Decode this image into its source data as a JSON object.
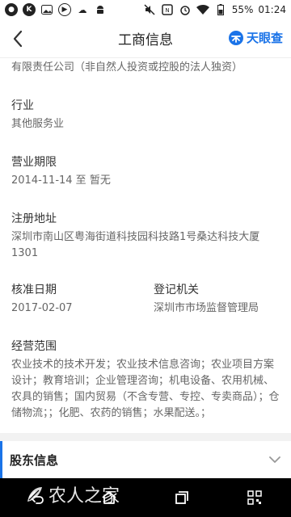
{
  "status_bar": {
    "battery": "55%",
    "time": "01:24",
    "icons": [
      "notification-circle-icon",
      "k-app-icon",
      "image-icon",
      "play-icon",
      "cloud-icon",
      "android-icon",
      "mute-icon",
      "nfc-icon",
      "alarm-icon",
      "wifi-icon",
      "battery-icon"
    ]
  },
  "header": {
    "title": "工商信息",
    "brand": "天眼查"
  },
  "content": {
    "company_type_tail": "有限责任公司（非自然人投资或控股的法人独资）",
    "industry": {
      "label": "行业",
      "value": "其他服务业"
    },
    "business_period": {
      "label": "营业期限",
      "value": "2014-11-14 至 暂无"
    },
    "registered_address": {
      "label": "注册地址",
      "value": "深圳市南山区粤海街道科技园科技路1号桑达科技大厦1301"
    },
    "approval_date": {
      "label": "核准日期",
      "value": "2017-02-07"
    },
    "registration_authority": {
      "label": "登记机关",
      "value": "深圳市市场监督管理局"
    },
    "business_scope": {
      "label": "经营范围",
      "value": "农业技术的技术开发；农业技术信息咨询；农业项目方案设计；教育培训；企业管理咨询；机电设备、农用机械、农具的销售；国内贸易（不含专营、专控、专卖商品）；仓储物流；；化肥、农药的销售；水果配送。；"
    }
  },
  "section": {
    "title": "股东信息"
  },
  "nav_bar": {
    "watermark": "农人之家"
  },
  "colors": {
    "accent": "#1a73e8",
    "label": "#333333",
    "value": "#666666"
  }
}
